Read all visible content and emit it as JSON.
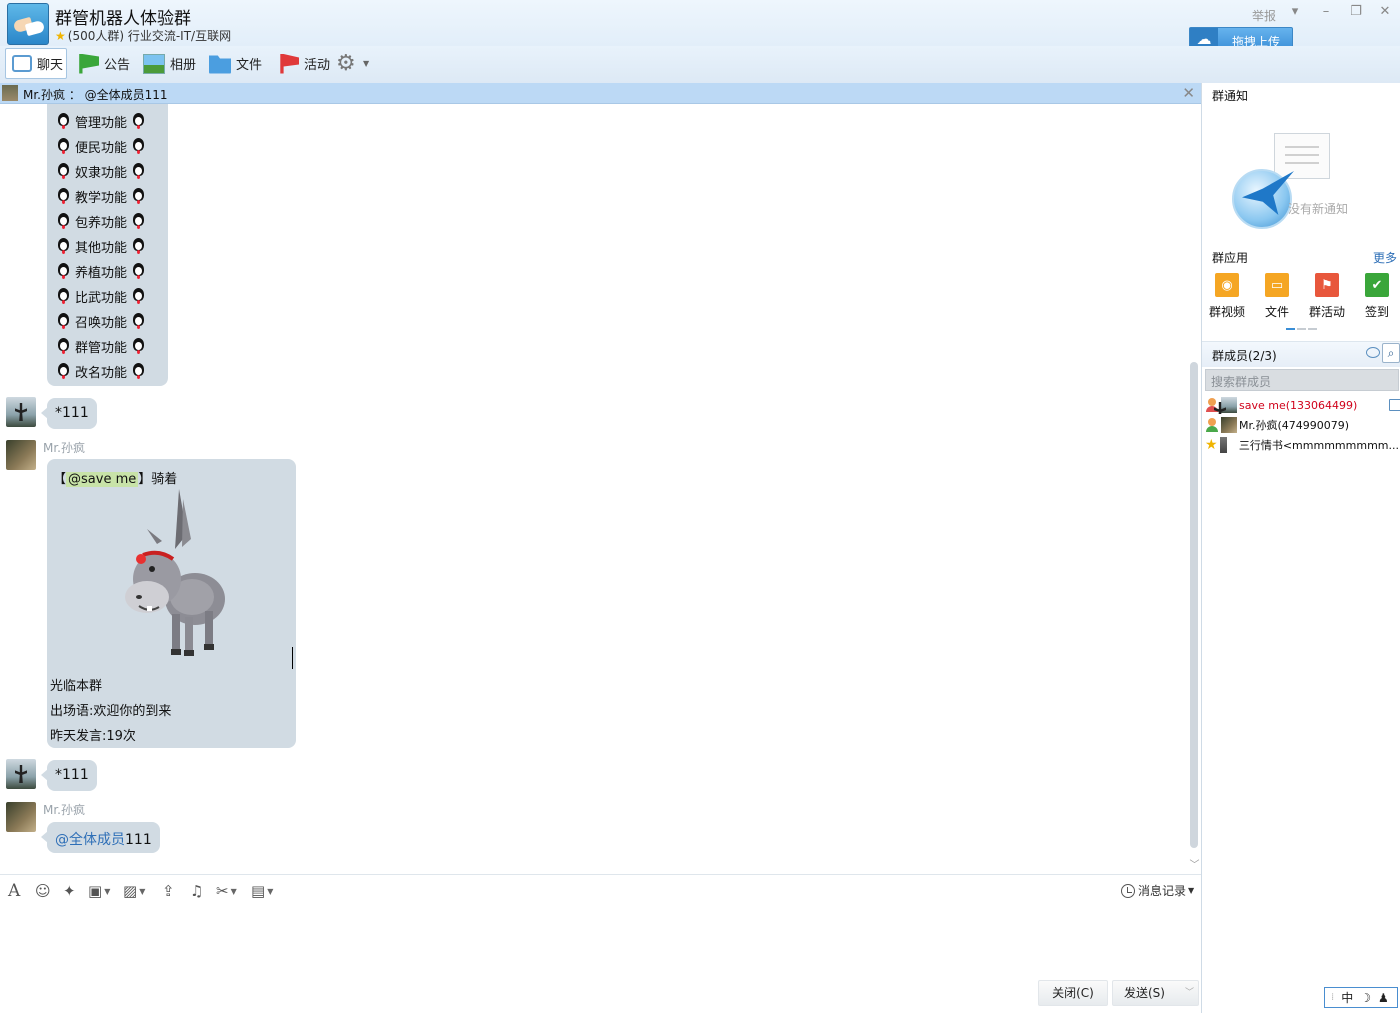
{
  "header": {
    "title": "群管机器人体验群",
    "subtitle": "(500人群) 行业交流-IT/互联网",
    "report": "举报",
    "upload_label": "拖拽上传"
  },
  "toolbar": {
    "items": [
      {
        "label": "聊天",
        "icon": "chat-icon"
      },
      {
        "label": "公告",
        "icon": "flag-icon"
      },
      {
        "label": "相册",
        "icon": "photo-icon"
      },
      {
        "label": "文件",
        "icon": "folder-icon"
      },
      {
        "label": "活动",
        "icon": "red-flag-icon"
      }
    ]
  },
  "announcement": {
    "text": "Mr.孙疯 ： @全体成员111"
  },
  "chat": {
    "menu_items": [
      "管理功能",
      "便民功能",
      "奴隶功能",
      "教学功能",
      "包养功能",
      "其他功能",
      "养植功能",
      "比武功能",
      "召唤功能",
      "群管功能",
      "改名功能"
    ],
    "messages": [
      {
        "text": "*111"
      },
      {
        "sender": "Mr.孙疯",
        "at_prefix": "【",
        "at_name": "@save me",
        "at_suffix": "】骑着",
        "line1": "光临本群",
        "line2": "出场语:欢迎你的到来",
        "line3": "昨天发言:19次"
      },
      {
        "text": "*111"
      },
      {
        "sender": "Mr.孙疯",
        "at_all": "@全体成员",
        "text": "111"
      }
    ]
  },
  "input": {
    "history_label": "消息记录",
    "close_label": "关闭(C)",
    "send_label": "发送(S)"
  },
  "right_panel": {
    "notice_title": "群通知",
    "no_notice": "没有新通知",
    "apps_title": "群应用",
    "more": "更多",
    "apps": [
      {
        "label": "群视频",
        "color": "#f5a623"
      },
      {
        "label": "文件",
        "color": "#f5a623"
      },
      {
        "label": "群活动",
        "color": "#e8573c"
      },
      {
        "label": "签到",
        "color": "#3aa63a"
      }
    ],
    "members_title": "群成员(2/3)",
    "search_placeholder": "搜索群成员",
    "members": [
      {
        "name": "save me(133064499)",
        "color": "#d0021b"
      },
      {
        "name": "Mr.孙疯(474990079)",
        "color": "#111111"
      },
      {
        "name": "三行情书<mmmmmmmmm...",
        "color": "#111111"
      }
    ]
  },
  "ime": {
    "mode": "中"
  }
}
